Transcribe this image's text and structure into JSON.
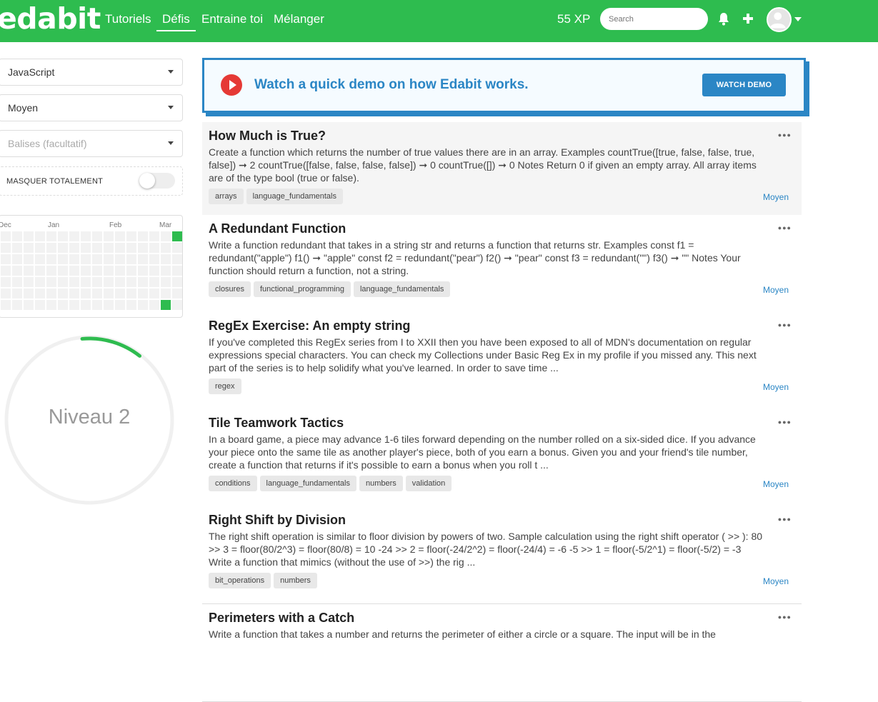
{
  "header": {
    "logo": "edabit",
    "nav": [
      "Tutoriels",
      "Défis",
      "Entraine toi",
      "Mélanger"
    ],
    "xp": "55 XP",
    "search_placeholder": "Search"
  },
  "sidebar": {
    "language": "JavaScript",
    "difficulty": "Moyen",
    "tags_placeholder": "Balises (facultatif)",
    "hide_label": "MASQUER TOTALEMENT",
    "hide_toggle_on": false,
    "heatmap_months": [
      "Dec",
      "Jan",
      "Feb",
      "Mar"
    ],
    "level_label": "Niveau 2",
    "level_progress": 0.12,
    "accent_color": "#2ebc4f"
  },
  "demo": {
    "text": "Watch a quick demo on how Edabit works.",
    "button": "WATCH DEMO"
  },
  "challenges": [
    {
      "title": "How Much is True?",
      "description": "Create a function which returns the number of true values there are in an array. Examples countTrue([true, false, false, true, false]) ➞ 2 countTrue([false, false, false, false]) ➞ 0 countTrue([]) ➞ 0 Notes Return 0 if given an empty array. All array items are of the type bool (true or false).",
      "tags": [
        "arrays",
        "language_fundamentals"
      ],
      "difficulty": "Moyen"
    },
    {
      "title": "A Redundant Function",
      "description": "Write a function redundant that takes in a string str and returns a function that returns str. Examples const f1 = redundant(\"apple\") f1() ➞ \"apple\" const f2 = redundant(\"pear\") f2() ➞ \"pear\" const f3 = redundant(\"\") f3() ➞ \"\" Notes Your function should return a function, not a string.",
      "tags": [
        "closures",
        "functional_programming",
        "language_fundamentals"
      ],
      "difficulty": "Moyen"
    },
    {
      "title": "RegEx Exercise: An empty string",
      "description": "If you've completed this RegEx series from I to XXII then you have been exposed to all of MDN's documentation on regular expressions special characters. You can check my Collections under Basic Reg Ex in my profile if you missed any. This next part of the series is to help solidify what you've learned. In order to save time ...",
      "tags": [
        "regex"
      ],
      "difficulty": "Moyen"
    },
    {
      "title": "Tile Teamwork Tactics",
      "description": "In a board game, a piece may advance 1-6 tiles forward depending on the number rolled on a six-sided dice. If you advance your piece onto the same tile as another player's piece, both of you earn a bonus. Given you and your friend's tile number, create a function that returns if it's possible to earn a bonus when you roll t ...",
      "tags": [
        "conditions",
        "language_fundamentals",
        "numbers",
        "validation"
      ],
      "difficulty": "Moyen"
    },
    {
      "title": "Right Shift by Division",
      "description": "The right shift operation is similar to floor division by powers of two. Sample calculation using the right shift operator ( >> ): 80 >> 3 = floor(80/2^3) = floor(80/8) = 10 -24 >> 2 = floor(-24/2^2) = floor(-24/4) = -6 -5 >> 1 = floor(-5/2^1) = floor(-5/2) = -3 Write a function that mimics (without the use of >>) the rig ...",
      "tags": [
        "bit_operations",
        "numbers"
      ],
      "difficulty": "Moyen"
    },
    {
      "title": "Perimeters with a Catch",
      "description": "Write a function that takes a number and returns the perimeter of either a circle or a square. The input will be in the",
      "tags": [],
      "difficulty": ""
    }
  ]
}
